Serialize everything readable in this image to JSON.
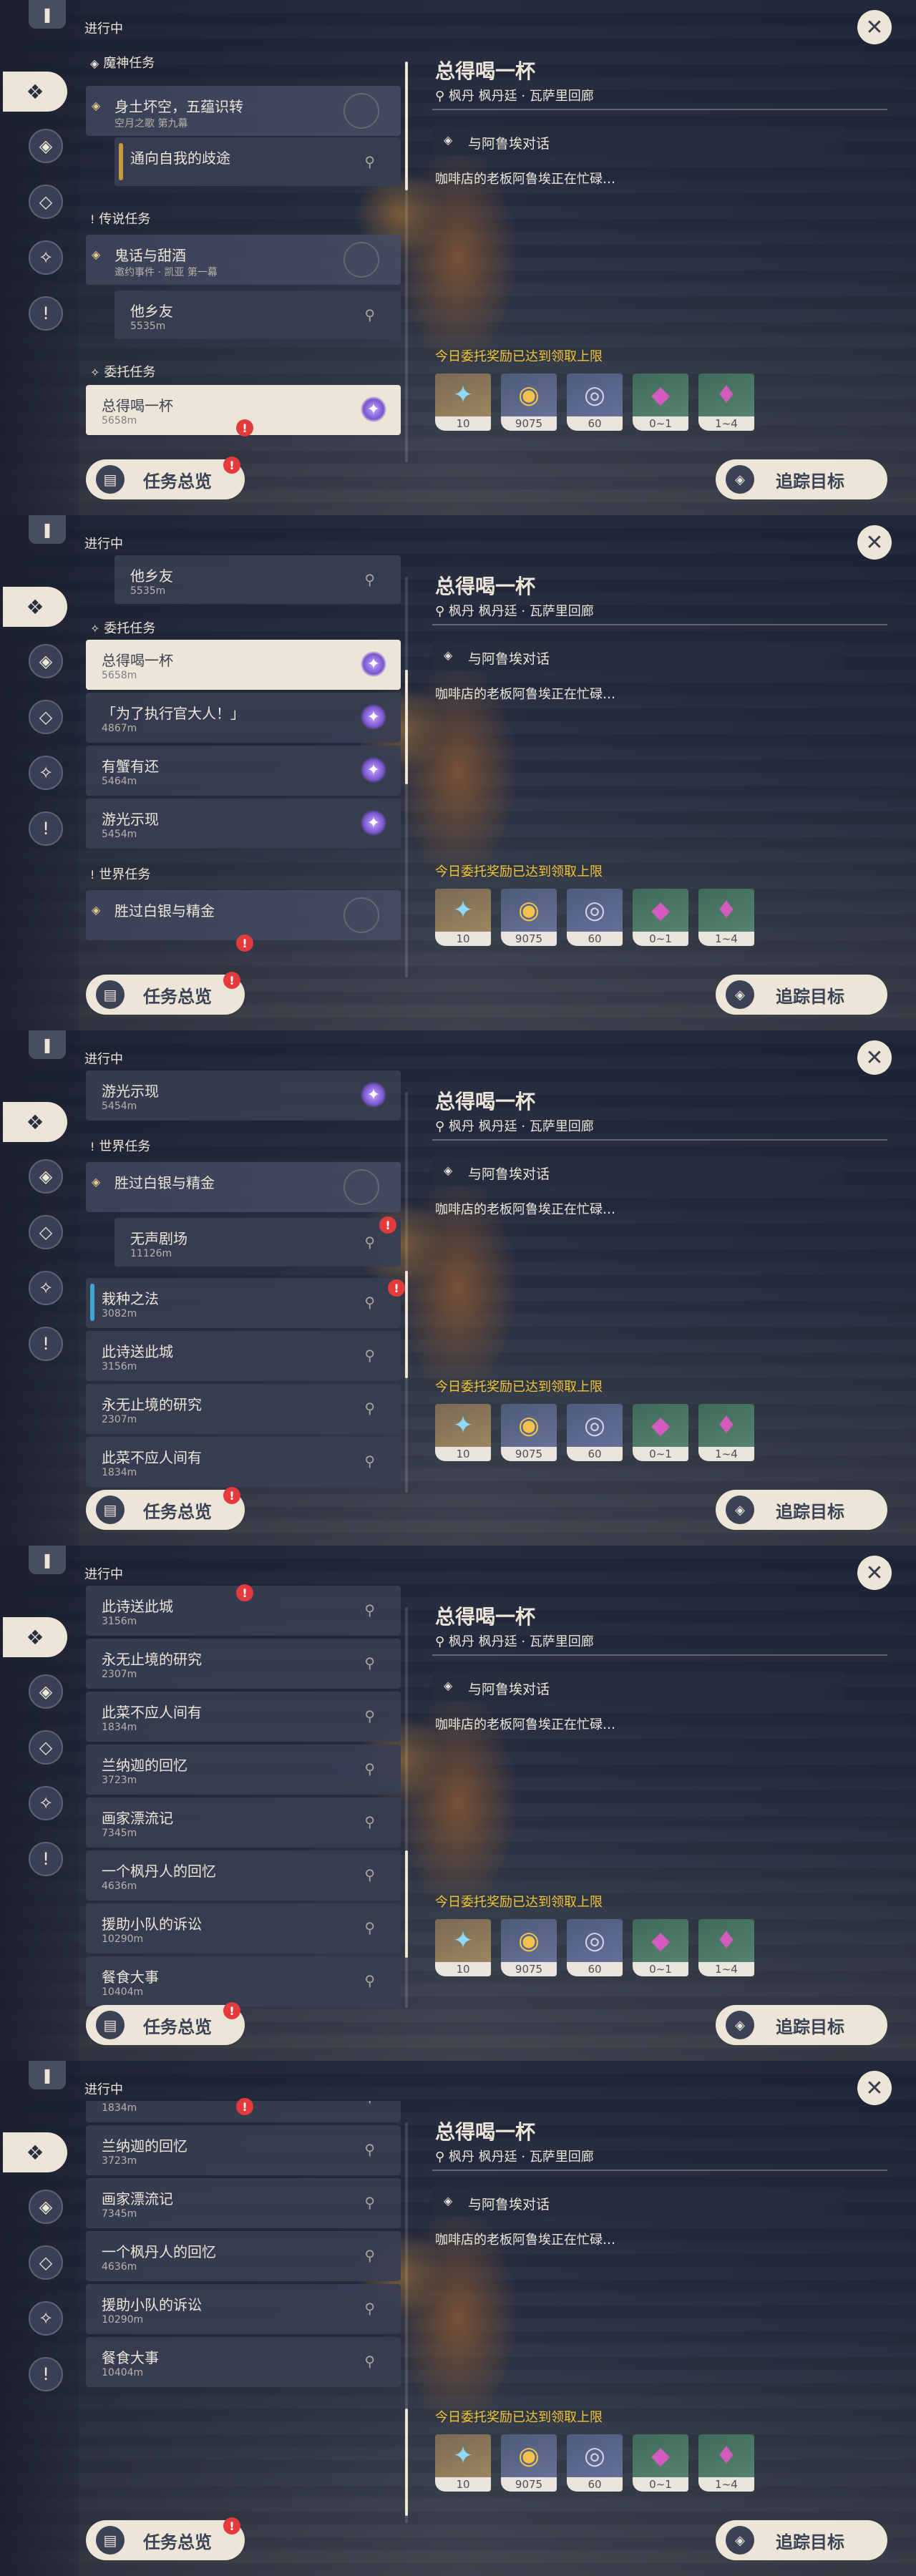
{
  "header": {
    "status": "进行中"
  },
  "sections": {
    "archon": "魔神任务",
    "story": "传说任务",
    "commission": "委托任务",
    "world": "世界任务"
  },
  "quests": {
    "archon_main": {
      "title": "身土坏空，五蕴识转",
      "sub": "空月之歌 第九幕"
    },
    "archon_step": {
      "title": "通向自我的歧途"
    },
    "story_main": {
      "title": "鬼话与甜酒",
      "sub": "邀约事件 · 凯亚 第一幕"
    },
    "story_step": {
      "title": "他乡友",
      "dist": "5535m"
    },
    "c1": {
      "title": "总得喝一杯",
      "dist": "5658m"
    },
    "c2": {
      "title": "「为了执行官大人！」",
      "dist": "4867m"
    },
    "c3": {
      "title": "有蟹有还",
      "dist": "5464m"
    },
    "c4": {
      "title": "游光示现",
      "dist": "5454m"
    },
    "world_main": {
      "title": "胜过白银与精金"
    },
    "world_step": {
      "title": "无声剧场",
      "dist": "11126m"
    },
    "w1": {
      "title": "栽种之法",
      "dist": "3082m"
    },
    "w2": {
      "title": "此诗送此城",
      "dist": "3156m"
    },
    "w3": {
      "title": "永无止境的研究",
      "dist": "2307m"
    },
    "w4": {
      "title": "此菜不应人间有",
      "dist": "1834m"
    },
    "w5": {
      "title": "兰纳迦的回忆",
      "dist": "3723m"
    },
    "w6": {
      "title": "画家漂流记",
      "dist": "7345m"
    },
    "w7": {
      "title": "一个枫丹人的回忆",
      "dist": "4636m"
    },
    "w8": {
      "title": "援助小队的诉讼",
      "dist": "10290m"
    },
    "w9": {
      "title": "餐食大事",
      "dist": "10404m"
    }
  },
  "detail": {
    "title": "总得喝一杯",
    "location": "枫丹 枫丹廷 · 瓦萨里回廊",
    "objective": "与阿鲁埃对话",
    "description": "咖啡店的老板阿鲁埃正在忙碌…",
    "reward_note": "今日委托奖励已达到领取上限",
    "rewards": [
      {
        "icon": "adventure-exp-icon",
        "count": "10"
      },
      {
        "icon": "mora-icon",
        "count": "9075"
      },
      {
        "icon": "friendship-exp-icon",
        "count": "60"
      },
      {
        "icon": "crystal-ore-icon",
        "count": "0~1"
      },
      {
        "icon": "crystal-cluster-icon",
        "count": "1~4"
      }
    ]
  },
  "buttons": {
    "overview": "任务总览",
    "track": "追踪目标",
    "close": "✕"
  },
  "colors": {
    "accent": "#ece5d8",
    "reward_note": "#f3c538",
    "alert": "#e33b3b",
    "panel": "#383e52"
  }
}
